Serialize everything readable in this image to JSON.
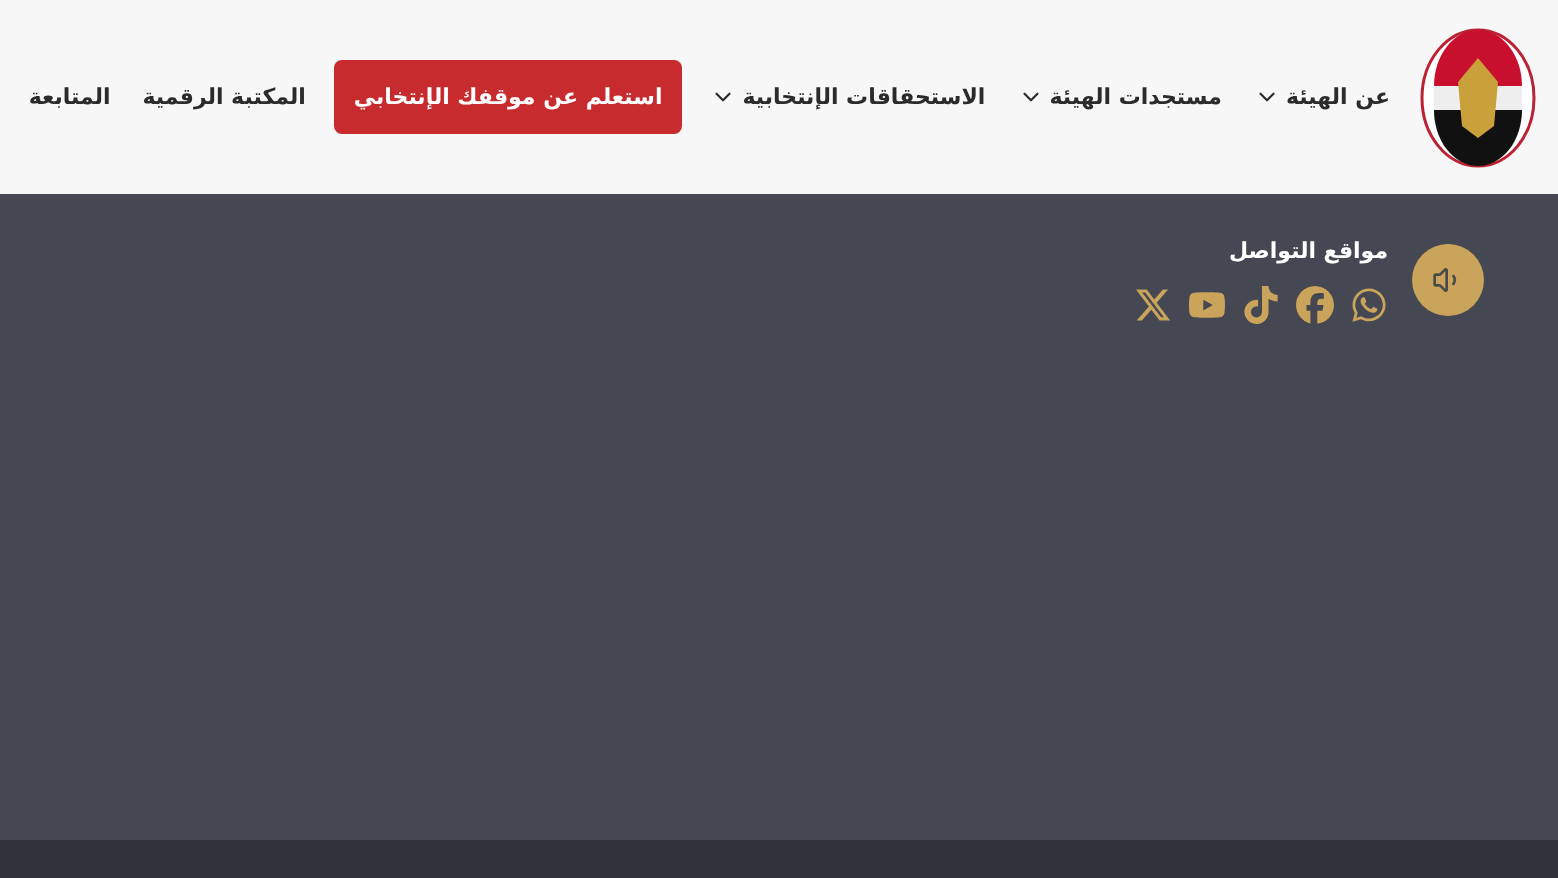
{
  "nav": {
    "items": [
      {
        "label": "عن الهيئة",
        "kind": "dropdown"
      },
      {
        "label": "مستجدات الهيئة",
        "kind": "dropdown"
      },
      {
        "label": "الاستحقاقات الإنتخابية",
        "kind": "dropdown"
      },
      {
        "label": "استعلم عن موقفك الإنتخابي",
        "kind": "button"
      },
      {
        "label": "المكتبة الرقمية",
        "kind": "link"
      },
      {
        "label": "المتابعة",
        "kind": "link"
      }
    ]
  },
  "social": {
    "title": "مواقع التواصل"
  }
}
